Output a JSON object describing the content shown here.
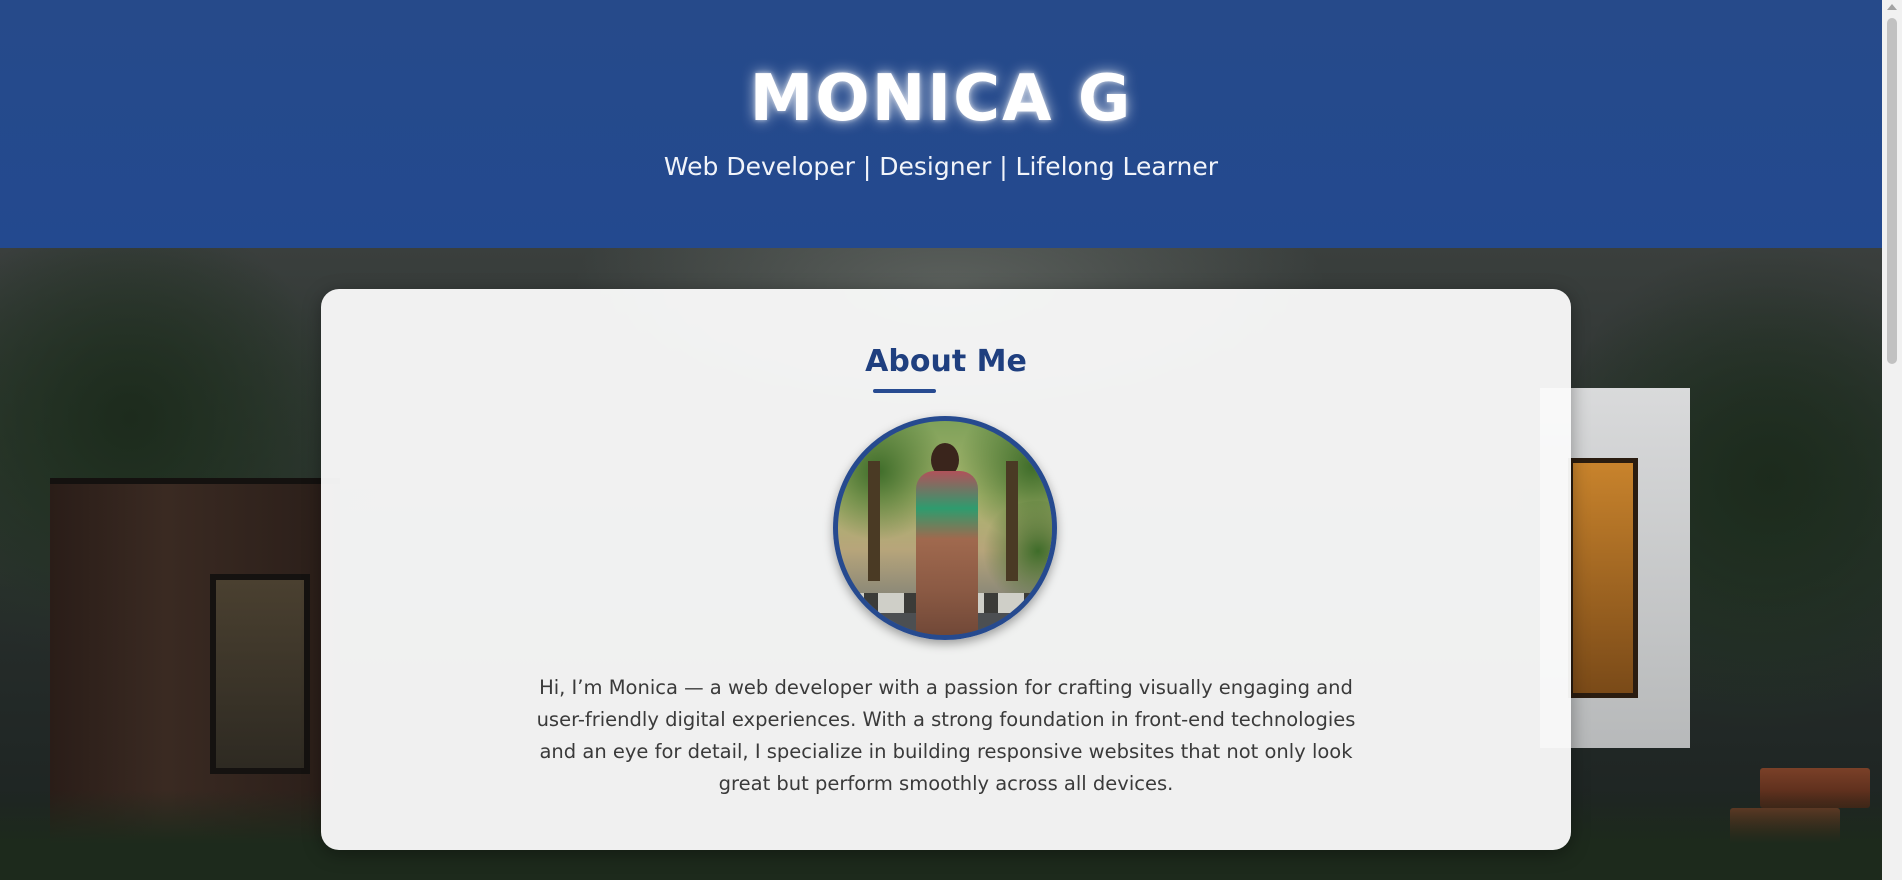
{
  "header": {
    "title": "MONICA G",
    "subtitle": "Web Developer | Designer | Lifelong Learner",
    "background_color": "#264a8a"
  },
  "about": {
    "heading": "About Me",
    "accent_color": "#274b91",
    "photo_icon": "profile-photo",
    "paragraph": "Hi, I’m Monica — a web developer with a passion for crafting visually engaging and user-friendly digital experiences. With a strong foundation in front-end technologies and an eye for detail, I specialize in building responsive websites that not only look great but perform smoothly across all devices."
  }
}
